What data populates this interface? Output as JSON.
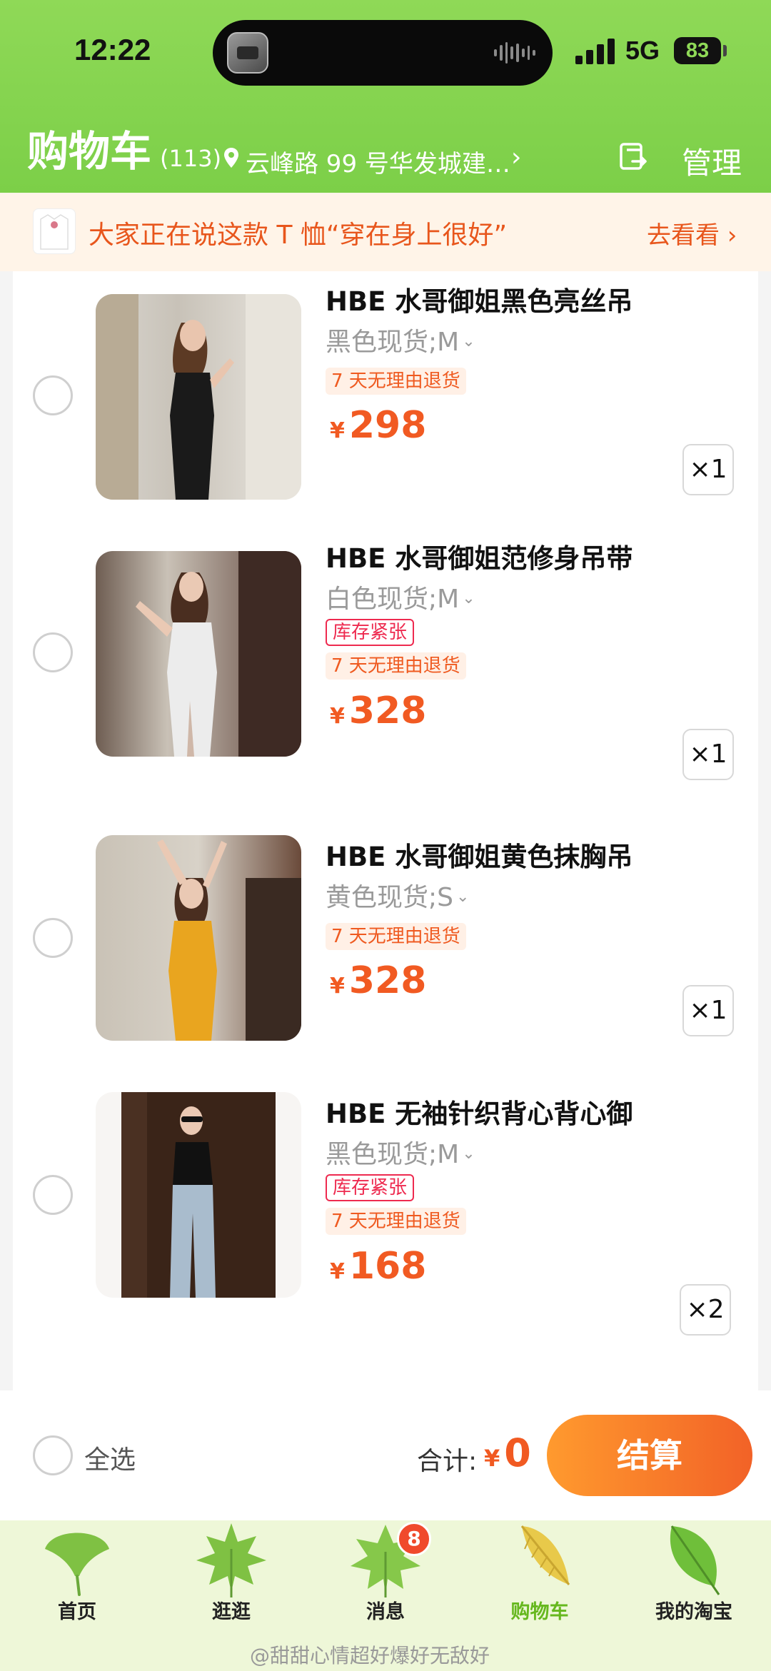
{
  "status_bar": {
    "time": "12:22",
    "network": "5G",
    "battery": "83"
  },
  "header": {
    "title": "购物车",
    "count": "(113)",
    "address": "云峰路 99 号华发城建…",
    "manage_label": "管理"
  },
  "banner": {
    "text": "大家正在说这款 T 恤“穿在身上很好”",
    "link_label": "去看看 ›"
  },
  "items": [
    {
      "name": "HBE 水哥御姐黑色亮丝吊",
      "spec": "黑色现货;M",
      "stock_tag": "",
      "return_tag": "7 天无理由退货",
      "currency": "¥",
      "price": "298",
      "qty": "×1"
    },
    {
      "name": "HBE 水哥御姐范修身吊带",
      "spec": "白色现货;M",
      "stock_tag": "库存紧张",
      "return_tag": "7 天无理由退货",
      "currency": "¥",
      "price": "328",
      "qty": "×1"
    },
    {
      "name": "HBE 水哥御姐黄色抹胸吊",
      "spec": "黄色现货;S",
      "stock_tag": "",
      "return_tag": "7 天无理由退货",
      "currency": "¥",
      "price": "328",
      "qty": "×1"
    },
    {
      "name": "HBE 无袖针织背心背心御",
      "spec": "黑色现货;M",
      "stock_tag": "库存紧张",
      "return_tag": "7 天无理由退货",
      "currency": "¥",
      "price": "168",
      "qty": "×2"
    }
  ],
  "checkout": {
    "select_all_label": "全选",
    "total_label": "合计:",
    "total_currency": "¥",
    "total_value": "0",
    "pay_label": "结算"
  },
  "tabbar": {
    "tabs": [
      {
        "label": "首页",
        "icon": "ginkgo-leaf-icon"
      },
      {
        "label": "逛逛",
        "icon": "maple-leaf-icon"
      },
      {
        "label": "消息",
        "icon": "maple-leaf-icon"
      },
      {
        "label": "购物车",
        "icon": "golden-leaf-icon"
      },
      {
        "label": "我的淘宝",
        "icon": "green-leaf-icon"
      }
    ],
    "active": "购物车",
    "message_badge": "8"
  },
  "watermark": "@甜甜心情超好爆好无敌好",
  "colors": {
    "accent_green": "#7ccf48",
    "price_orange": "#f15a22",
    "stock_red": "#ee2a4f"
  }
}
